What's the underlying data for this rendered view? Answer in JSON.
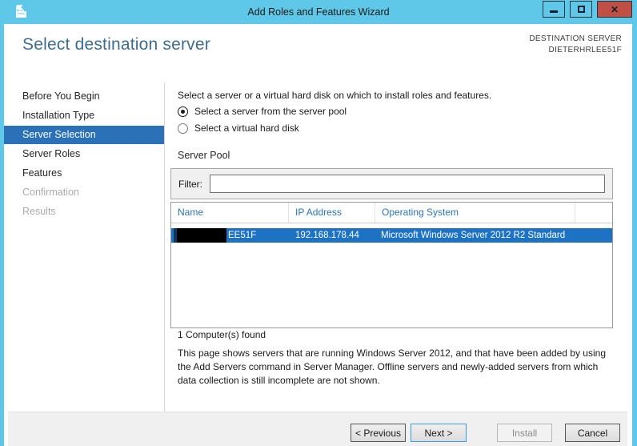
{
  "window": {
    "title": "Add Roles and Features Wizard",
    "icons": {
      "minimize": "minimize-icon",
      "maximize": "maximize-icon",
      "close": "✕"
    }
  },
  "header": {
    "title": "Select destination server",
    "destination_label": "DESTINATION SERVER",
    "destination_server": "DIETERHRLEE51F"
  },
  "sidebar": {
    "items": [
      {
        "label": "Before You Begin",
        "state": "enabled"
      },
      {
        "label": "Installation Type",
        "state": "enabled"
      },
      {
        "label": "Server Selection",
        "state": "selected"
      },
      {
        "label": "Server Roles",
        "state": "enabled"
      },
      {
        "label": "Features",
        "state": "enabled"
      },
      {
        "label": "Confirmation",
        "state": "disabled"
      },
      {
        "label": "Results",
        "state": "disabled"
      }
    ]
  },
  "main": {
    "intro": "Select a server or a virtual hard disk on which to install roles and features.",
    "radios": [
      {
        "label": "Select a server from the server pool",
        "selected": true
      },
      {
        "label": "Select a virtual hard disk",
        "selected": false
      }
    ],
    "server_pool": {
      "label": "Server Pool",
      "filter_label": "Filter:",
      "filter_value": ""
    },
    "table": {
      "columns": [
        "Name",
        "IP Address",
        "Operating System"
      ],
      "rows": [
        {
          "name_visible": "EE51F",
          "name_redacted": true,
          "ip": "192.168.178.44",
          "os": "Microsoft Windows Server 2012 R2 Standard",
          "selected": true
        }
      ]
    },
    "found_text": "1 Computer(s) found",
    "description": "This page shows servers that are running Windows Server 2012, and that have been added by using the Add Servers command in Server Manager. Offline servers and newly-added servers from which data collection is still incomplete are not shown."
  },
  "footer": {
    "buttons": [
      {
        "label": "< Previous",
        "enabled": true
      },
      {
        "label": "Next >",
        "enabled": true,
        "default": true
      },
      {
        "label": "Install",
        "enabled": false
      },
      {
        "label": "Cancel",
        "enabled": true
      }
    ]
  },
  "colors": {
    "titlebar": "#5FC8E8",
    "close_button": "#C05046",
    "sidebar_selected": "#2B71B8",
    "row_selected": "#1D72C4",
    "heading": "#3E6D8E",
    "column_header_text": "#2D73B5",
    "footer_background": "#F0F0F0"
  }
}
